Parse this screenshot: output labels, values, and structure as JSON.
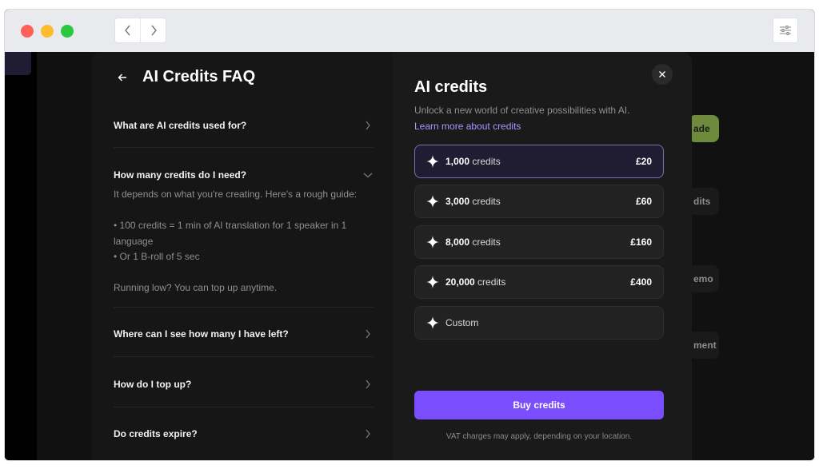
{
  "faq": {
    "title": "AI Credits FAQ",
    "items": [
      {
        "question": "What are AI credits used for?",
        "expanded": false
      },
      {
        "question": "How many credits do I need?",
        "expanded": true,
        "answer": {
          "intro": "It depends on what you're creating. Here's a rough guide:",
          "bullet1_line1": "• 100 credits = 1 min of AI translation for 1 speaker in 1",
          "bullet1_line2": "language",
          "bullet2": "• Or 1 B-roll of 5 sec",
          "footer": "Running low? You can top up anytime."
        }
      },
      {
        "question": "Where can I see how many I have left?",
        "expanded": false
      },
      {
        "question": "How do I top up?",
        "expanded": false
      },
      {
        "question": "Do credits expire?",
        "expanded": false
      }
    ]
  },
  "credits": {
    "title": "AI credits",
    "subtitle": "Unlock a new world of creative possibilities with AI.",
    "learn_more": "Learn more about credits",
    "options": [
      {
        "amount": "1,000",
        "unit": " credits",
        "price": "£20",
        "selected": true
      },
      {
        "amount": "3,000",
        "unit": " credits",
        "price": "£60",
        "selected": false
      },
      {
        "amount": "8,000",
        "unit": " credits",
        "price": "£160",
        "selected": false
      },
      {
        "amount": "20,000",
        "unit": " credits",
        "price": "£400",
        "selected": false
      },
      {
        "amount": "",
        "unit": "Custom",
        "price": "",
        "selected": false
      }
    ],
    "buy_label": "Buy credits",
    "vat_note": "VAT charges may apply, depending on your location."
  },
  "background": {
    "button1": "ade",
    "button2": "dits",
    "button3": "emo",
    "button4": "ment"
  },
  "colors": {
    "accent": "#7a4dff",
    "link": "#a995ff",
    "selected_border": "#7a70b0"
  },
  "icons": {
    "back": "arrow-left-icon",
    "close": "close-icon",
    "collapsed": "chevron-right-icon",
    "expanded": "chevron-down-icon",
    "option": "sparkle-icon",
    "settings": "sliders-icon"
  }
}
